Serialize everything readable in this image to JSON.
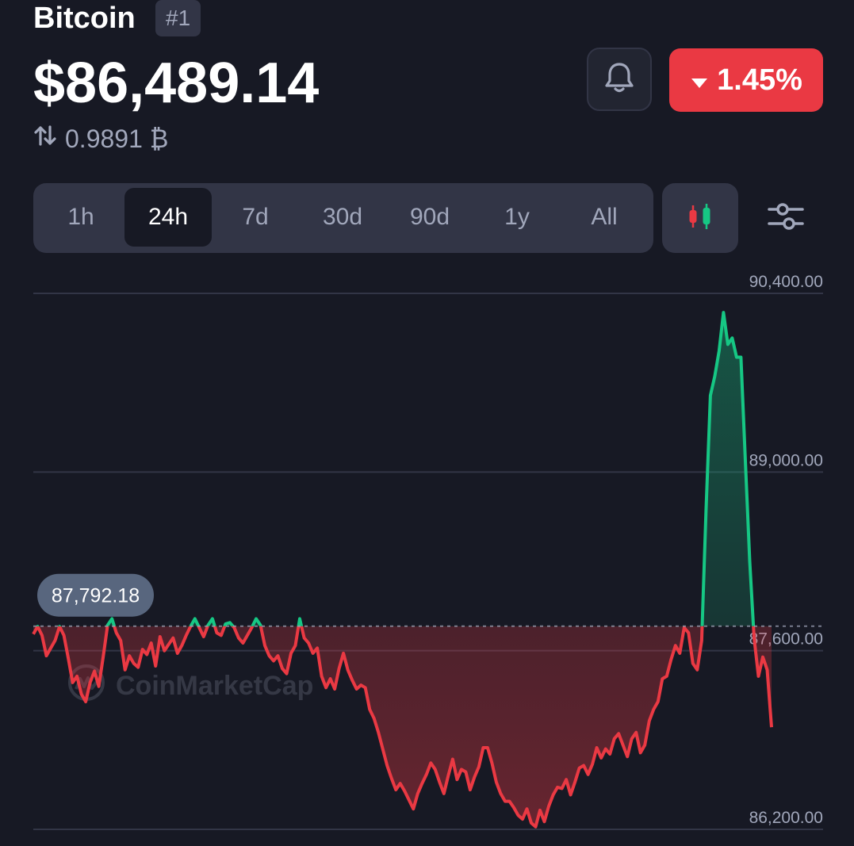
{
  "header": {
    "coin_name": "Bitcoin",
    "rank": "#1",
    "price": "$86,489.14",
    "btc_value": "0.9891 ₿",
    "change_pct": "1.45%",
    "change_direction": "down"
  },
  "timeframes": [
    {
      "label": "1h",
      "active": false
    },
    {
      "label": "24h",
      "active": true
    },
    {
      "label": "7d",
      "active": false
    },
    {
      "label": "30d",
      "active": false
    },
    {
      "label": "90d",
      "active": false
    },
    {
      "label": "1y",
      "active": false
    },
    {
      "label": "All",
      "active": false
    }
  ],
  "icons": {
    "bell": "bell-icon",
    "candles": "candlestick-icon",
    "settings": "sliders-icon",
    "swap": "swap-arrows-icon"
  },
  "colors": {
    "background": "#171924",
    "up": "#16c784",
    "down": "#ea3943",
    "panel": "#323546",
    "muted": "#a1a7bb"
  },
  "watermark": "CoinMarketCap",
  "chart_data": {
    "type": "line",
    "ylim": [
      86200,
      90400
    ],
    "y_ticks": [
      "90,400.00",
      "89,000.00",
      "87,600.00",
      "86,200.00"
    ],
    "y_tick_values": [
      90400,
      89000,
      87600,
      86200
    ],
    "baseline_value": 87792.18,
    "baseline_label": "87,792.18",
    "grid": true,
    "values": [
      87730,
      87790,
      87720,
      87560,
      87620,
      87680,
      87790,
      87720,
      87540,
      87350,
      87400,
      87260,
      87200,
      87350,
      87440,
      87320,
      87550,
      87800,
      87850,
      87740,
      87680,
      87450,
      87560,
      87500,
      87470,
      87610,
      87570,
      87660,
      87480,
      87710,
      87600,
      87650,
      87700,
      87580,
      87640,
      87720,
      87790,
      87850,
      87780,
      87710,
      87800,
      87850,
      87740,
      87720,
      87810,
      87820,
      87780,
      87700,
      87660,
      87720,
      87780,
      87850,
      87800,
      87640,
      87560,
      87520,
      87560,
      87460,
      87420,
      87580,
      87640,
      87850,
      87700,
      87660,
      87580,
      87620,
      87400,
      87310,
      87380,
      87300,
      87460,
      87580,
      87450,
      87370,
      87300,
      87330,
      87310,
      87140,
      87070,
      86960,
      86830,
      86700,
      86600,
      86510,
      86560,
      86500,
      86430,
      86360,
      86480,
      86560,
      86630,
      86720,
      86670,
      86570,
      86480,
      86620,
      86750,
      86590,
      86670,
      86650,
      86510,
      86610,
      86690,
      86840,
      86840,
      86720,
      86570,
      86480,
      86420,
      86420,
      86370,
      86310,
      86280,
      86360,
      86250,
      86220,
      86350,
      86260,
      86380,
      86470,
      86530,
      86520,
      86590,
      86470,
      86570,
      86680,
      86700,
      86630,
      86710,
      86840,
      86760,
      86830,
      86790,
      86910,
      86950,
      86860,
      86770,
      86910,
      86960,
      86800,
      86860,
      87050,
      87140,
      87200,
      87380,
      87400,
      87530,
      87640,
      87580,
      87780,
      87740,
      87500,
      87450,
      87680,
      88700,
      89600,
      89750,
      89950,
      90250,
      90000,
      90050,
      89900,
      89900,
      89100,
      88300,
      87700,
      87400,
      87550,
      87450,
      87000
    ],
    "line_color_above": "#16c784",
    "line_color_below": "#ea3943"
  }
}
